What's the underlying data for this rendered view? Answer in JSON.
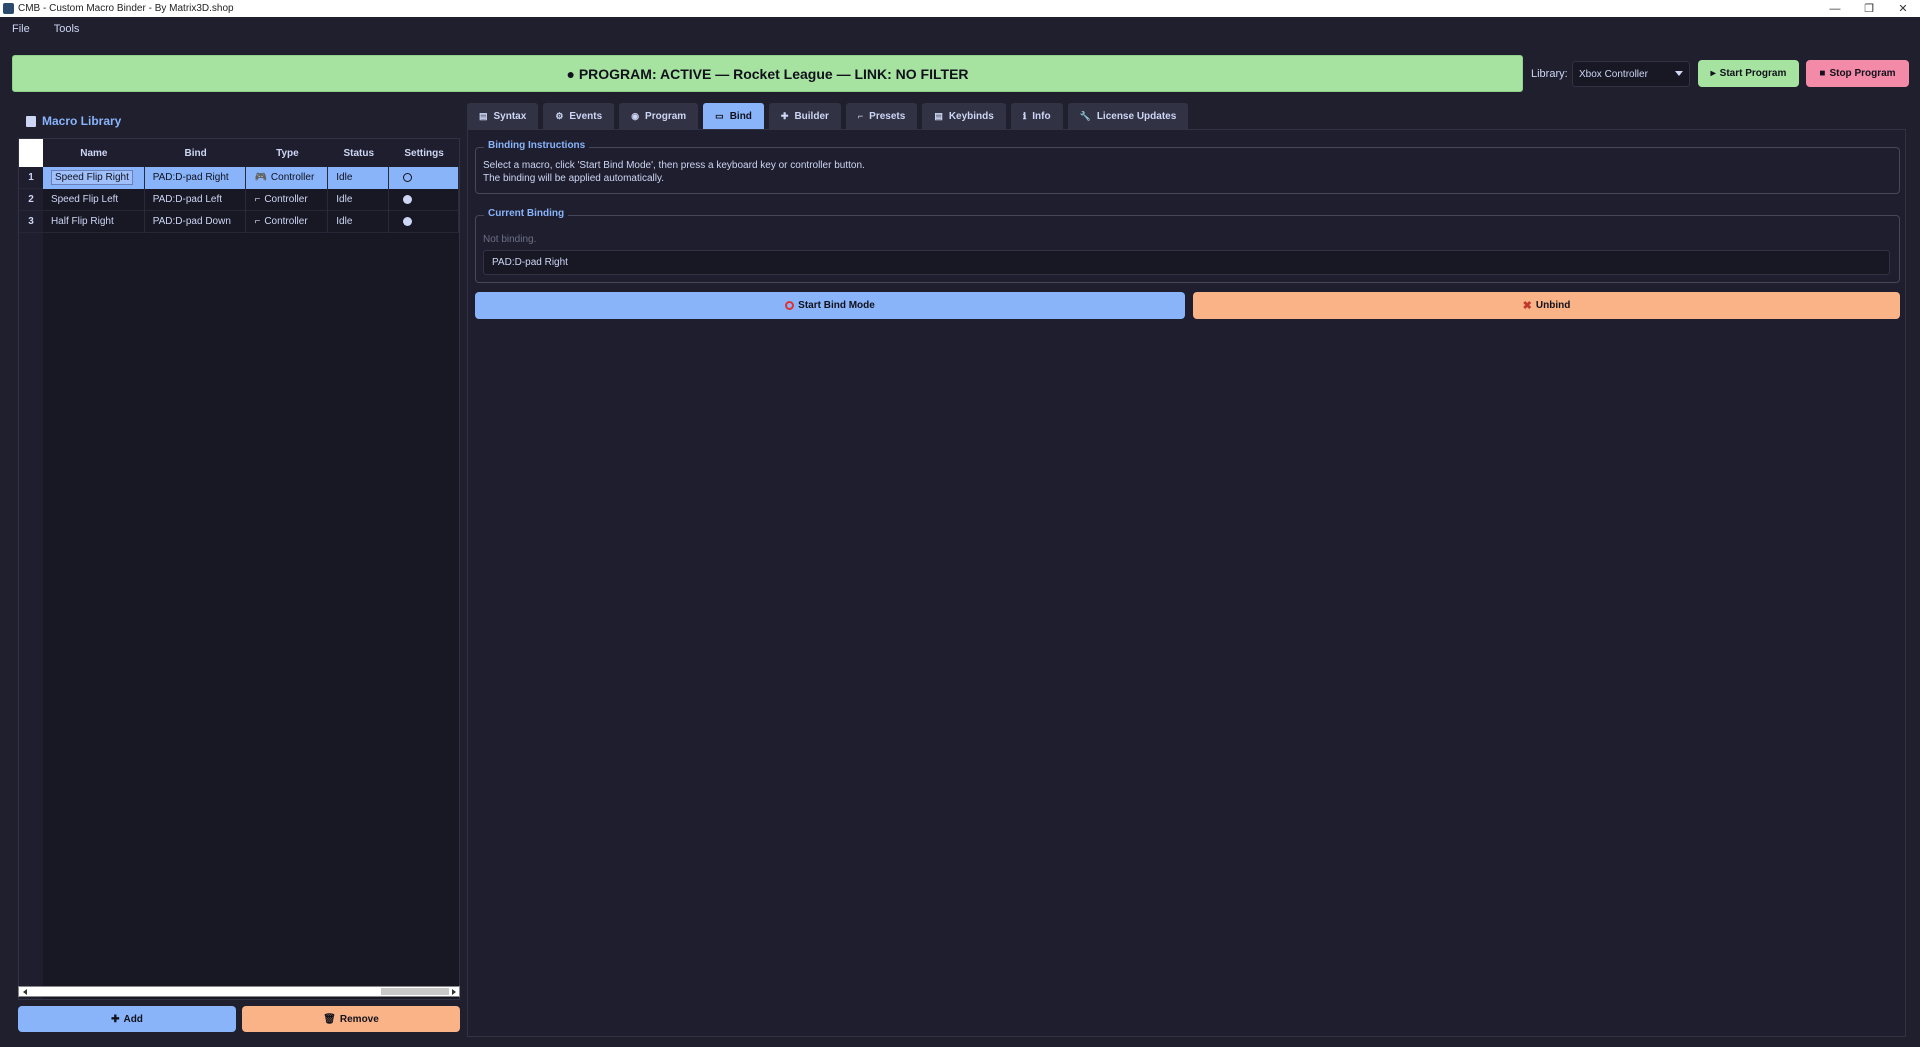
{
  "window": {
    "title": "CMB - Custom Macro Binder - By Matrix3D.shop",
    "minimize": "—",
    "maximize": "❐",
    "close": "✕"
  },
  "menu": [
    "File",
    "Tools"
  ],
  "banner": {
    "text": "● PROGRAM: ACTIVE — Rocket League — LINK: NO FILTER",
    "color": "#a6e3a1"
  },
  "library": {
    "label": "Library:",
    "selected": "Xbox Controller"
  },
  "toolbar": {
    "start_label": "Start Program",
    "start_icon": "play-icon",
    "stop_label": "Stop Program",
    "stop_icon": "stop-icon"
  },
  "sidebar": {
    "title": "Macro Library",
    "columns": [
      "Name",
      "Bind",
      "Type",
      "Status",
      "Settings"
    ],
    "rows": [
      {
        "num": "1",
        "name": "Speed Flip Right",
        "bind": "PAD:D-pad Right",
        "type": "Controller",
        "type_icon": "🎮",
        "status": "Idle",
        "selected": true
      },
      {
        "num": "2",
        "name": "Speed Flip Left",
        "bind": "PAD:D-pad Left",
        "type": "Controller",
        "type_icon": "⌐",
        "status": "Idle",
        "selected": false
      },
      {
        "num": "3",
        "name": "Half Flip Right",
        "bind": "PAD:D-pad Down",
        "type": "Controller",
        "type_icon": "⌐",
        "status": "Idle",
        "selected": false
      }
    ],
    "add_label": "Add",
    "remove_label": "Remove"
  },
  "tabs": [
    {
      "label": "Syntax",
      "icon": "▤",
      "active": false
    },
    {
      "label": "Events",
      "icon": "⚙",
      "active": false
    },
    {
      "label": "Program",
      "icon": "◉",
      "active": false
    },
    {
      "label": "Bind",
      "icon": "▭",
      "active": true
    },
    {
      "label": "Builder",
      "icon": "✚",
      "active": false
    },
    {
      "label": "Presets",
      "icon": "⌐",
      "active": false
    },
    {
      "label": "Keybinds",
      "icon": "▤",
      "active": false
    },
    {
      "label": "Info",
      "icon": "ℹ",
      "active": false
    },
    {
      "label": "License  Updates",
      "icon": "🔧",
      "active": false
    }
  ],
  "bind_tab": {
    "instructions_title": "Binding Instructions",
    "instructions_line1": "Select a macro, click 'Start Bind Mode', then press a keyboard key or controller button.",
    "instructions_line2": "The binding will be applied automatically.",
    "current_title": "Current Binding",
    "status_text": "Not binding.",
    "current_value": "PAD:D-pad Right",
    "start_bind_label": "Start Bind Mode",
    "unbind_label": "Unbind"
  },
  "colors": {
    "accent_blue": "#89b4fa",
    "accent_green": "#a6e3a1",
    "accent_red": "#f38ba8",
    "accent_orange": "#fab387",
    "background": "#1f1f2e"
  }
}
